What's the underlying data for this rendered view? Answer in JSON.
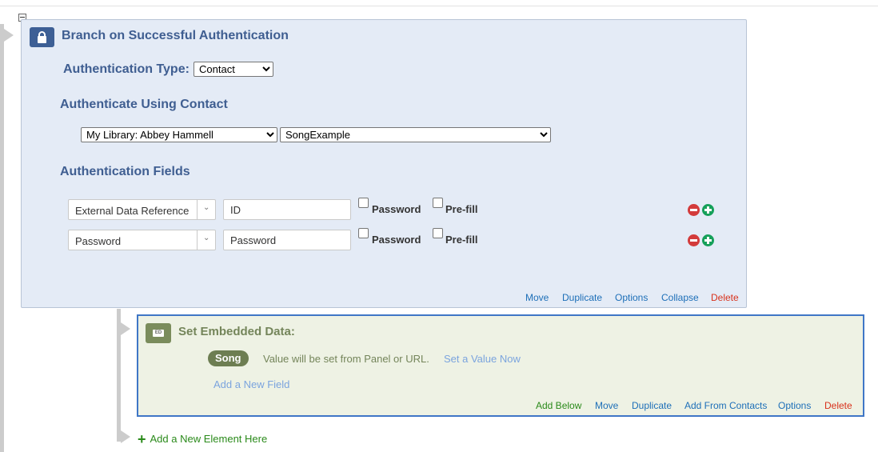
{
  "auth_block": {
    "title": "Branch on Successful Authentication",
    "auth_type_label": "Authentication Type:",
    "auth_type_value": "Contact",
    "using_contact_heading": "Authenticate Using Contact",
    "library_value": "My Library: Abbey Hammell",
    "contact_list_value": "SongExample",
    "fields_heading": "Authentication Fields",
    "fields": [
      {
        "field_type": "External Data Reference",
        "value": "ID",
        "password_label": "Password",
        "password_checked": false,
        "prefill_label": "Pre-fill",
        "prefill_checked": false
      },
      {
        "field_type": "Password",
        "value": "Password",
        "password_label": "Password",
        "password_checked": false,
        "prefill_label": "Pre-fill",
        "prefill_checked": false
      }
    ],
    "actions": {
      "move": "Move",
      "duplicate": "Duplicate",
      "options": "Options",
      "collapse": "Collapse",
      "delete": "Delete"
    }
  },
  "embedded_block": {
    "badge": "ED",
    "title": "Set Embedded Data:",
    "field_name": "Song",
    "value_text": "Value will be set from Panel or URL.",
    "set_value_link": "Set a Value Now",
    "add_field_link": "Add a New Field",
    "actions": {
      "add_below": "Add Below",
      "move": "Move",
      "duplicate": "Duplicate",
      "add_from_contacts": "Add From Contacts",
      "options": "Options",
      "delete": "Delete"
    }
  },
  "add_element_label": "Add a New Element Here",
  "colors": {
    "auth_bg": "#e4ebf6",
    "auth_heading": "#3f5e91",
    "ed_bg": "#eef2e4",
    "ed_heading": "#74855a",
    "link": "#1d6fb8",
    "delete": "#d8321c",
    "add": "#2a8a1a",
    "selected_border": "#3f76c6"
  }
}
